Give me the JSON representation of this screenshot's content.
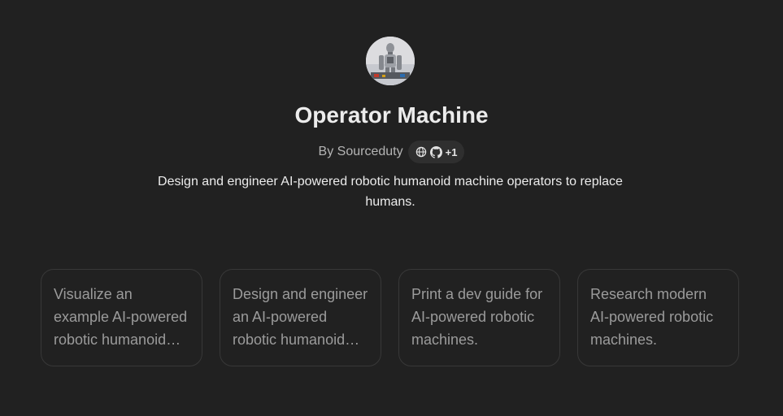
{
  "gpt": {
    "name": "Operator Machine",
    "author_prefix": "By",
    "author": "Sourceduty",
    "links_count": "+1",
    "description": "Design and engineer AI-powered robotic humanoid machine operators to replace humans.",
    "avatar_icon": "robot-avatar"
  },
  "conversation_starters": [
    "Visualize an example AI-powered robotic humanoid machine operator.",
    "Design and engineer an AI-powered robotic humanoid machine operator.",
    "Print a dev guide for AI-powered robotic machines.",
    "Research modern AI-powered robotic machines."
  ],
  "colors": {
    "background": "#212121",
    "title": "#ececec",
    "muted_text": "#b4b4b4",
    "starter_text": "#9b9b9b",
    "starter_border": "#383838",
    "pill_background": "#2f2f2f"
  }
}
